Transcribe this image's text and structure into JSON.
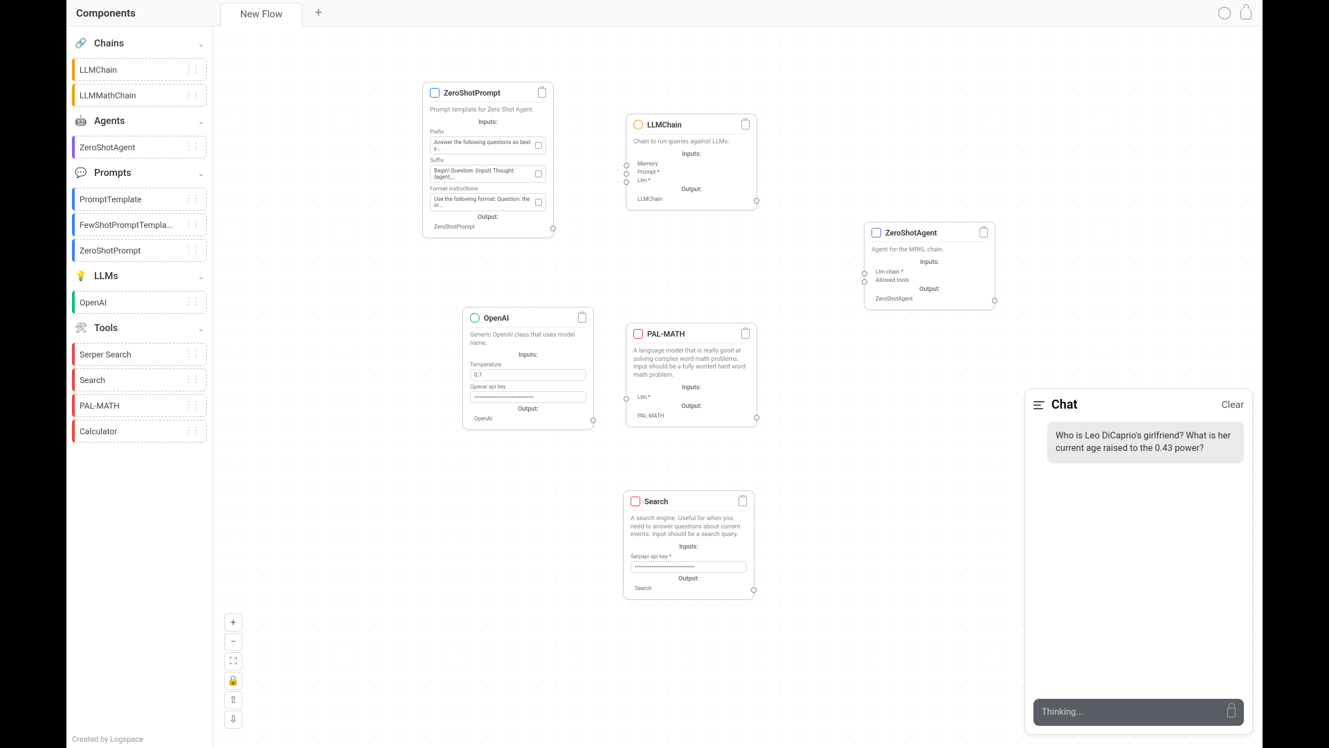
{
  "header": {
    "sidebar_title": "Components",
    "tab": "New Flow"
  },
  "sidebar": {
    "cats": [
      {
        "name": "Chains",
        "icon": "🔗",
        "color": "c-orange",
        "items": [
          "LLMChain",
          "LLMMathChain"
        ]
      },
      {
        "name": "Agents",
        "icon": "🤖",
        "color": "c-purple",
        "items": [
          "ZeroShotAgent"
        ]
      },
      {
        "name": "Prompts",
        "icon": "💬",
        "color": "c-blue",
        "items": [
          "PromptTemplate",
          "FewShotPromptTempla...",
          "ZeroShotPrompt"
        ]
      },
      {
        "name": "LLMs",
        "icon": "💡",
        "color": "c-green",
        "items": [
          "OpenAI"
        ]
      },
      {
        "name": "Tools",
        "icon": "🛠",
        "color": "c-red",
        "items": [
          "Serper Search",
          "Search",
          "PAL-MATH",
          "Calculator"
        ]
      }
    ],
    "footer": "Created by Logspace"
  },
  "nodes": {
    "zsp": {
      "title": "ZeroShotPrompt",
      "desc": "Prompt template for Zero Shot Agent.",
      "inputs": "Inputs:",
      "output": "Output:",
      "fields": [
        {
          "label": "Prefix",
          "value": "Answer the following questions as best y..."
        },
        {
          "label": "Suffix",
          "value": "Begin! Question: {input} Thought:{agent_..."
        },
        {
          "label": "Format instructions",
          "value": "Use the following format: Question: the in..."
        }
      ],
      "out": "ZeroShotPrompt"
    },
    "llmchain": {
      "title": "LLMChain",
      "desc": "Chain to run queries against LLMs.",
      "inputs": "Inputs:",
      "output": "Output:",
      "ports": [
        "Memory",
        "Prompt *",
        "Llm *"
      ],
      "out": "LLMChain"
    },
    "zsa": {
      "title": "ZeroShotAgent",
      "desc": "Agent for the MRKL chain.",
      "inputs": "Inputs:",
      "output": "Output:",
      "ports": [
        "Llm chain *",
        "Allowed tools"
      ],
      "out": "ZeroShotAgent"
    },
    "openai": {
      "title": "OpenAI",
      "desc": "Generic OpenAI class that uses model name.",
      "inputs": "Inputs:",
      "output": "Output:",
      "fields": [
        {
          "label": "Temperature",
          "value": "0.7"
        },
        {
          "label": "Openai api key",
          "value": "••••••••••••••••••••••••••••••••"
        }
      ],
      "out": "OpenAI"
    },
    "palmath": {
      "title": "PAL-MATH",
      "desc": "A language model that is really good at solving complex word math problems. Input should be a fully worded hard word math problem.",
      "inputs": "Inputs:",
      "output": "Output:",
      "ports": [
        "Llm *"
      ],
      "out": "PAL-MATH"
    },
    "search": {
      "title": "Search",
      "desc": "A search engine. Useful for when you need to answer questions about current events. Input should be a search query.",
      "inputs": "Inputs:",
      "output": "Output:",
      "fields": [
        {
          "label": "Serpapi api key *",
          "value": "••••••••••••••••••••••••••••••••"
        }
      ],
      "out": "Search"
    }
  },
  "chat": {
    "title": "Chat",
    "clear": "Clear",
    "message": "Who is Leo DiCaprio's girlfriend? What is her current age raised to the 0.43 power?",
    "input": "Thinking..."
  }
}
